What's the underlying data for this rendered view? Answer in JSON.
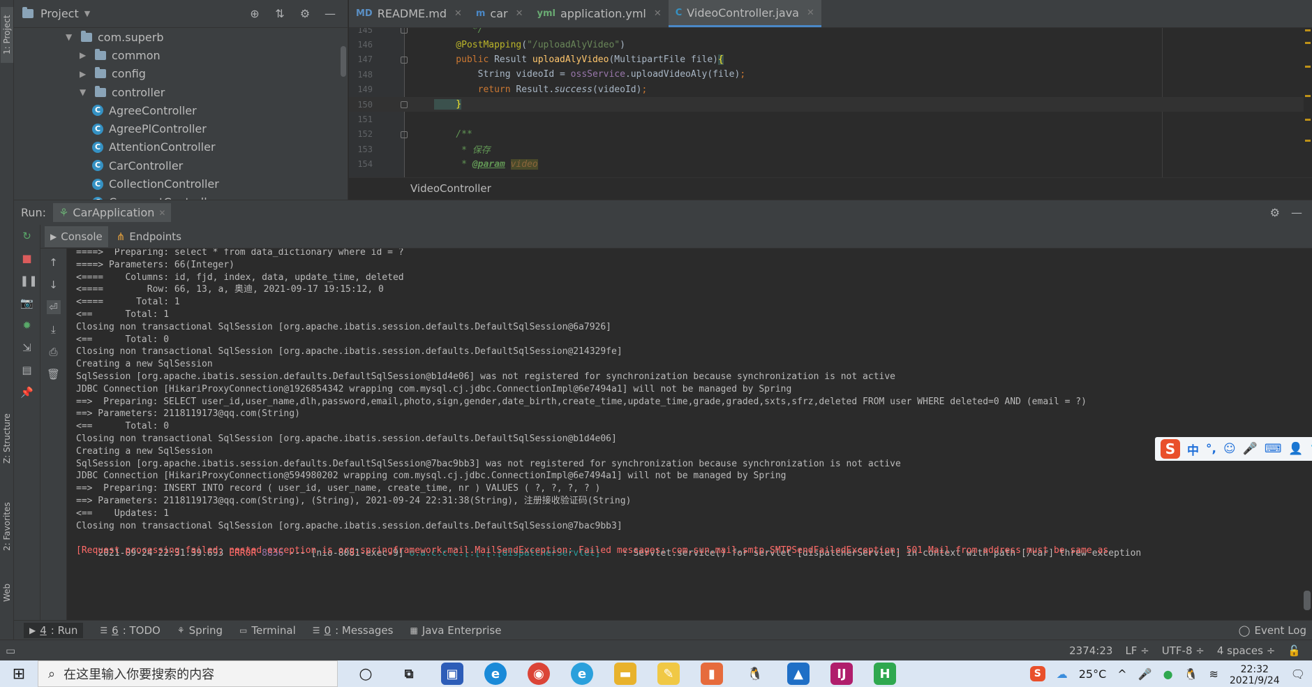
{
  "left_strip": {
    "project_tab": "1: Project",
    "structure_tab": "Z: Structure",
    "favorites_tab": "2: Favorites",
    "web_tab": "Web"
  },
  "project_panel": {
    "title": "Project",
    "tree": [
      {
        "label": "com.superb",
        "type": "package",
        "depth": 0,
        "expanded": true
      },
      {
        "label": "common",
        "type": "package",
        "depth": 1,
        "expanded": false
      },
      {
        "label": "config",
        "type": "package",
        "depth": 1,
        "expanded": false
      },
      {
        "label": "controller",
        "type": "package",
        "depth": 1,
        "expanded": true
      },
      {
        "label": "AgreeController",
        "type": "class",
        "depth": 2
      },
      {
        "label": "AgreePlController",
        "type": "class",
        "depth": 2
      },
      {
        "label": "AttentionController",
        "type": "class",
        "depth": 2
      },
      {
        "label": "CarController",
        "type": "class",
        "depth": 2
      },
      {
        "label": "CollectionController",
        "type": "class",
        "depth": 2
      },
      {
        "label": "CommentController",
        "type": "class",
        "depth": 2
      }
    ]
  },
  "editor_tabs": [
    {
      "label": "README.md",
      "icon": "MD"
    },
    {
      "label": "car",
      "icon": "m"
    },
    {
      "label": "application.yml",
      "icon": "yml"
    },
    {
      "label": "VideoController.java",
      "icon": "C",
      "active": true
    }
  ],
  "code_lines": [
    {
      "n": "145",
      "segs": [
        [
          "cmt",
          "       */"
        ]
      ]
    },
    {
      "n": "146",
      "segs": [
        [
          "annot",
          "    @PostMapping"
        ],
        [
          "plain",
          "("
        ],
        [
          "str",
          "\"/uploadAlyVideo\""
        ],
        [
          "plain",
          ")"
        ]
      ]
    },
    {
      "n": "147",
      "segs": [
        [
          "kw",
          "    public "
        ],
        [
          "plain",
          "Result "
        ],
        [
          "fn",
          "uploadAlyVideo"
        ],
        [
          "plain",
          "(MultipartFile file)"
        ],
        [
          "brace",
          "{"
        ]
      ]
    },
    {
      "n": "148",
      "segs": [
        [
          "plain",
          "        String videoId = "
        ],
        [
          "fld",
          "ossService"
        ],
        [
          "plain",
          ".uploadVideoAly(file)"
        ],
        [
          "kw",
          ";"
        ]
      ]
    },
    {
      "n": "149",
      "segs": [
        [
          "kw",
          "        return "
        ],
        [
          "plain",
          "Result."
        ],
        [
          "em",
          "success"
        ],
        [
          "plain",
          "(videoId)"
        ],
        [
          "kw",
          ";"
        ]
      ]
    },
    {
      "n": "150",
      "segs": [
        [
          "brace",
          "    }"
        ]
      ],
      "current": true
    },
    {
      "n": "151",
      "segs": []
    },
    {
      "n": "152",
      "segs": [
        [
          "cmt",
          "    /**"
        ]
      ]
    },
    {
      "n": "153",
      "segs": [
        [
          "cmt",
          "     * 保存"
        ]
      ]
    },
    {
      "n": "154",
      "segs": [
        [
          "cmt",
          "     * "
        ],
        [
          "tag",
          "@param"
        ],
        [
          "cmt",
          " "
        ],
        [
          "pname",
          "video"
        ]
      ]
    }
  ],
  "breadcrumb": "VideoController",
  "run": {
    "label": "Run:",
    "config_name": "CarApplication",
    "console_tab": "Console",
    "endpoints_tab": "Endpoints"
  },
  "console_lines": [
    "====>  Preparing: select * from data_dictionary where id = ?",
    "====> Parameters: 66(Integer)",
    "<====    Columns: id, fjd, index, data, update_time, deleted",
    "<====        Row: 66, 13, a, 奥迪, 2021-09-17 19:15:12, 0",
    "<====      Total: 1",
    "<==      Total: 1",
    "Closing non transactional SqlSession [org.apache.ibatis.session.defaults.DefaultSqlSession@6a7926]",
    "<==      Total: 0",
    "Closing non transactional SqlSession [org.apache.ibatis.session.defaults.DefaultSqlSession@214329fe]",
    "Creating a new SqlSession",
    "SqlSession [org.apache.ibatis.session.defaults.DefaultSqlSession@b1d4e06] was not registered for synchronization because synchronization is not active",
    "JDBC Connection [HikariProxyConnection@1926854342 wrapping com.mysql.cj.jdbc.ConnectionImpl@6e7494a1] will not be managed by Spring",
    "==>  Preparing: SELECT user_id,user_name,dlh,password,email,photo,sign,gender,date_birth,create_time,update_time,grade,graded,sxts,sfrz,deleted FROM user WHERE deleted=0 AND (email = ?)",
    "==> Parameters: 2118119173@qq.com(String)",
    "<==      Total: 0",
    "Closing non transactional SqlSession [org.apache.ibatis.session.defaults.DefaultSqlSession@b1d4e06]",
    "Creating a new SqlSession",
    "SqlSession [org.apache.ibatis.session.defaults.DefaultSqlSession@7bac9bb3] was not registered for synchronization because synchronization is not active",
    "JDBC Connection [HikariProxyConnection@594980202 wrapping com.mysql.cj.jdbc.ConnectionImpl@6e7494a1] will not be managed by Spring",
    "==>  Preparing: INSERT INTO record ( user_id, user_name, create_time, nr ) VALUES ( ?, ?, ?, ? )",
    "==> Parameters: 2118119173@qq.com(String), (String), 2021-09-24 22:31:38(String), 注册接收验证码(String)",
    "<==    Updates: 1",
    "Closing non transactional SqlSession [org.apache.ibatis.session.defaults.DefaultSqlSession@7bac9bb3]"
  ],
  "error_line": {
    "timestamp": "2021-09-24 22:31:39.693",
    "level": "ERROR",
    "pid": "8836",
    "thread": "--- [nio-8081-exec-9]",
    "logger": "o.a.c.c.C.[.[.[.[dispatcherServlet]",
    "message": "    : Servlet.service() for servlet [dispatcherServlet] in context with path [/car] threw exception"
  },
  "exception_line": "[Request processing failed; nested exception is org.springframework.mail.MailSendException: Failed messages: com.sun.mail.smtp.SMTPSendFailedException: 501 Mail from address must be same as",
  "ime": {
    "lang": "中",
    "punct": "°,"
  },
  "tool_windows": [
    {
      "key": "4",
      "label": ": Run",
      "active": true
    },
    {
      "key": "6",
      "label": ": TODO"
    },
    {
      "key": "",
      "label": "Spring"
    },
    {
      "key": "",
      "label": "Terminal"
    },
    {
      "key": "0",
      "label": ": Messages"
    },
    {
      "key": "",
      "label": "Java Enterprise"
    }
  ],
  "event_log": "Event Log",
  "status": {
    "position": "2374:23",
    "line_sep": "LF ÷",
    "encoding": "UTF-8 ÷",
    "indent": "4 spaces ÷"
  },
  "taskbar": {
    "search_placeholder": "在这里输入你要搜索的内容",
    "temperature": "25°C",
    "time": "22:32",
    "date": "2021/9/24"
  },
  "colors": {
    "accent": "#4a88c7",
    "error": "#ff6b68",
    "annotation": "#bbb529",
    "keyword": "#cc7832"
  }
}
